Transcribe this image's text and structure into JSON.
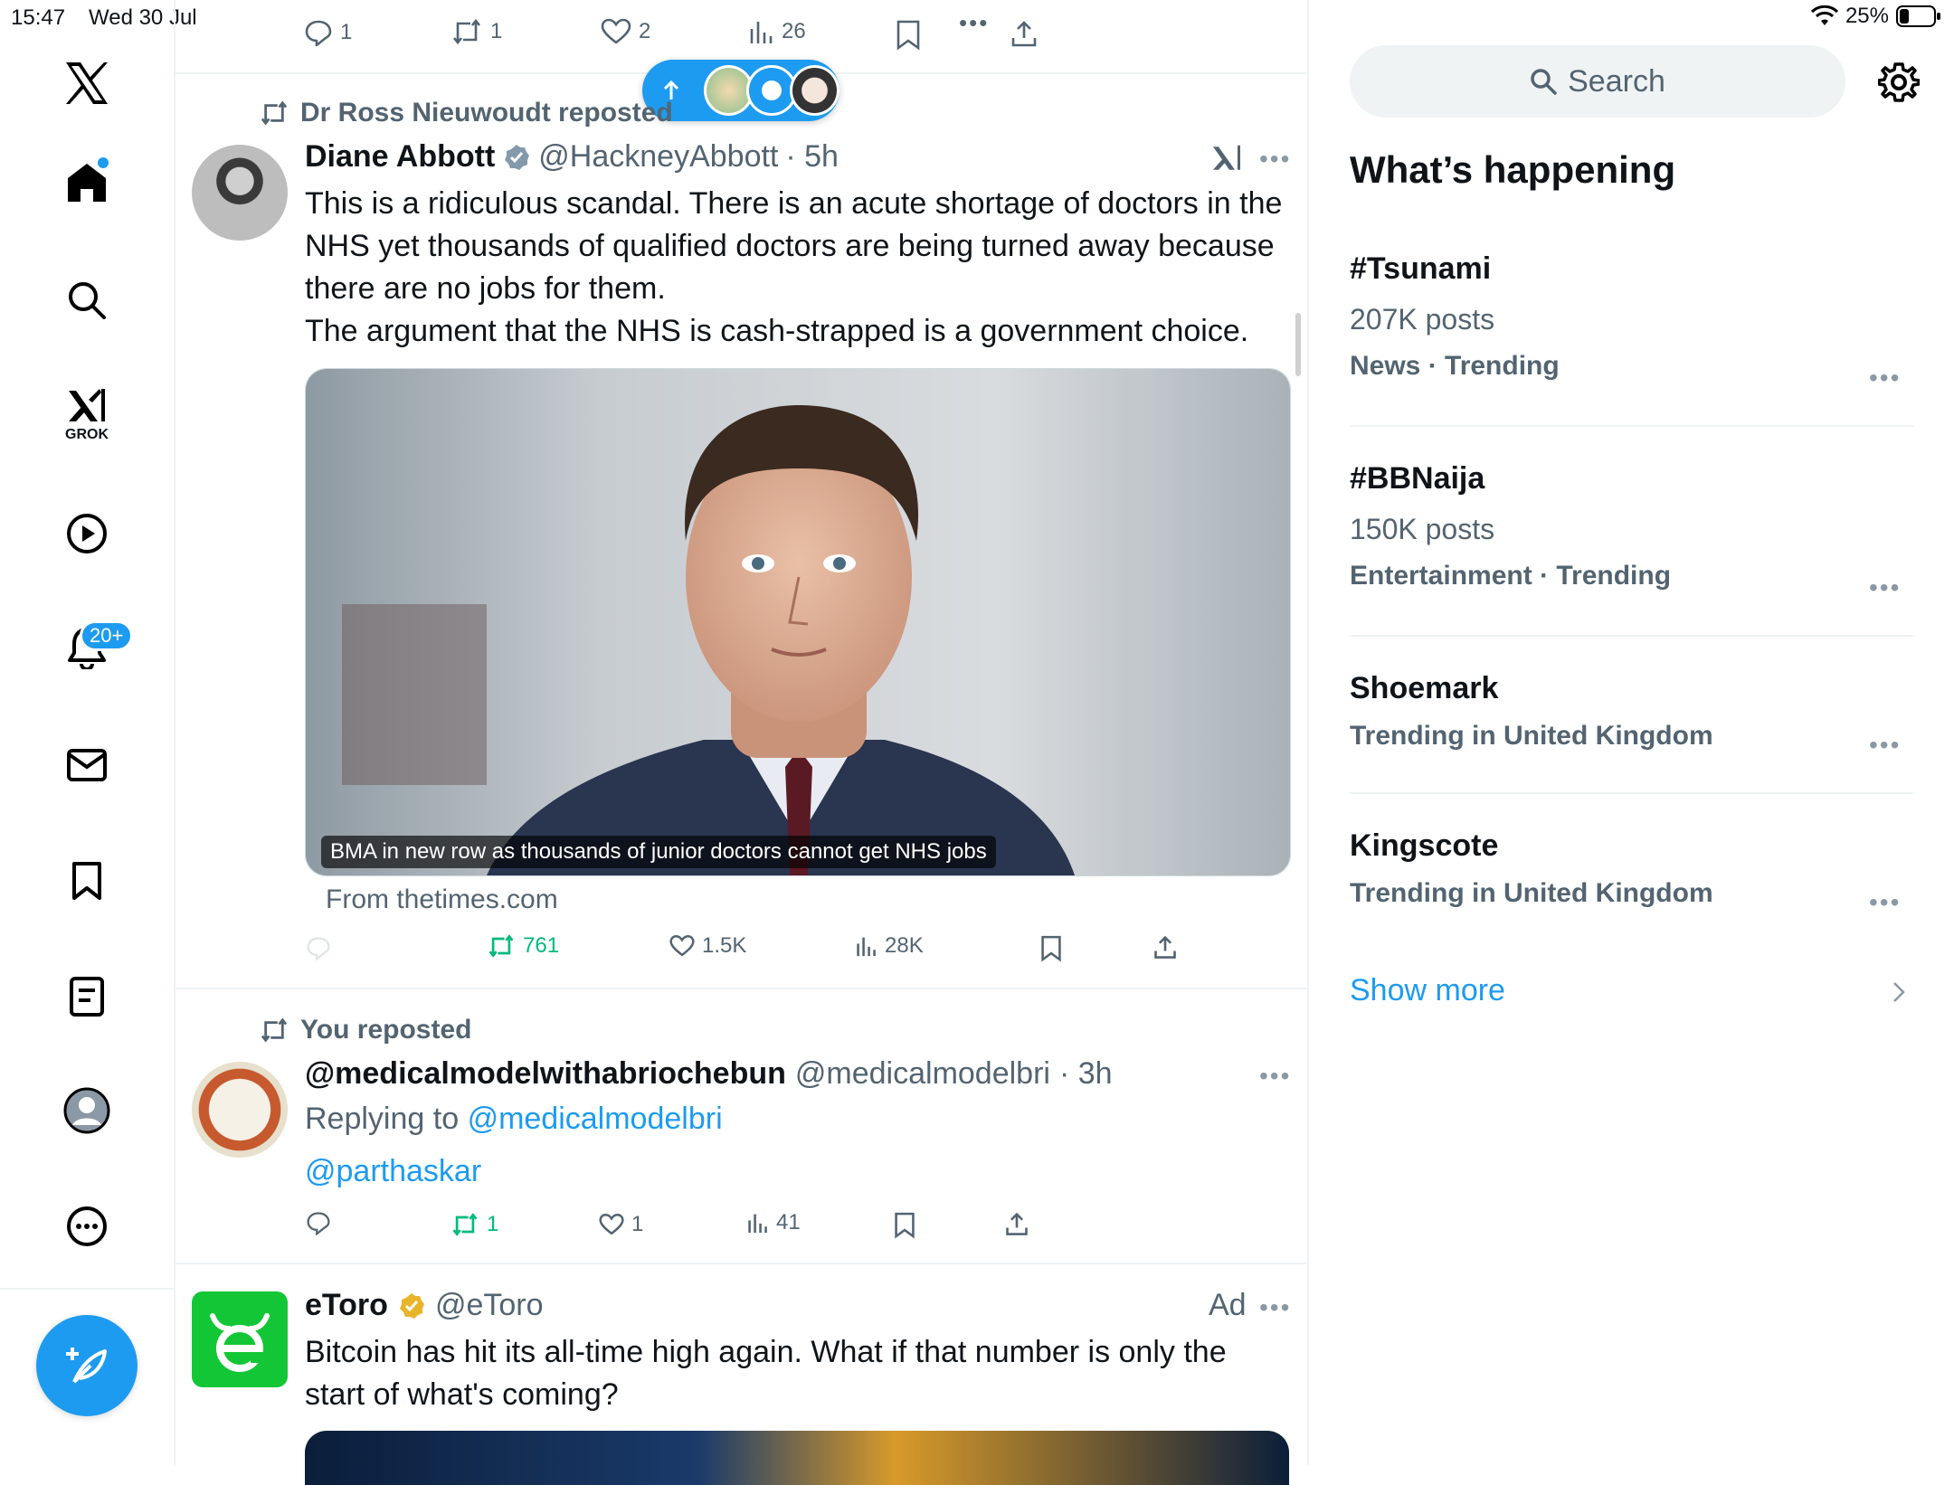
{
  "status": {
    "time": "15:47",
    "date": "Wed 30 Jul",
    "battery": "25%"
  },
  "nav": {
    "grok_label": "GROK",
    "notifications_badge": "20+"
  },
  "top_actions": {
    "replies": "1",
    "reposts": "1",
    "likes": "2",
    "views": "26"
  },
  "tweet1": {
    "repost_by": "Dr Ross Nieuwoudt reposted",
    "name": "Diane Abbott",
    "handle": "@HackneyAbbott",
    "time": "· 5h",
    "text_lines": [
      "This is a ridiculous scandal. There is an acute shortage of doctors in the",
      "NHS yet thousands of qualified doctors are being turned away because",
      "there are no jobs for them.",
      "The argument that the NHS is cash-strapped is a government choice."
    ],
    "card_caption": "BMA in new row as thousands of junior doctors cannot get NHS jobs",
    "card_source": "From thetimes.com",
    "reposts": "761",
    "likes": "1.5K",
    "views": "28K"
  },
  "tweet2": {
    "repost_by": "You reposted",
    "name": "@medicalmodelwithabriochebun",
    "handle": "@medicalmodelbri",
    "time": "· 3h",
    "replying_prefix": "Replying to",
    "replying_to": "@medicalmodelbri",
    "mention": "@parthaskar",
    "reposts": "1",
    "likes": "1",
    "views": "41"
  },
  "tweet3": {
    "name": "eToro",
    "handle": "@eToro",
    "ad_label": "Ad",
    "text_lines": [
      "Bitcoin has hit its all-time high again.  What if that number is only the",
      "start of what's coming?"
    ]
  },
  "sidebar": {
    "search_placeholder": "Search",
    "heading": "What’s happening",
    "trends": [
      {
        "title": "#Tsunami",
        "posts": "207K posts",
        "meta": "News · Trending"
      },
      {
        "title": "#BBNaija",
        "posts": "150K posts",
        "meta": "Entertainment · Trending"
      },
      {
        "title": "Shoemark",
        "meta": "Trending in United Kingdom"
      },
      {
        "title": "Kingscote",
        "meta": "Trending in United Kingdom"
      }
    ],
    "show_more": "Show more"
  },
  "colors": {
    "accent": "#1d9bf0",
    "repost_green": "#00ba7c",
    "secondary_text": "#536471"
  }
}
